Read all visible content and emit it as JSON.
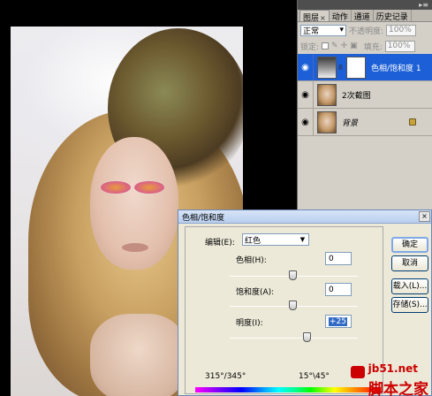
{
  "layers_panel": {
    "tabs": [
      {
        "label": "图层",
        "close": "×"
      },
      {
        "label": "动作"
      },
      {
        "label": "通道"
      },
      {
        "label": "历史记录"
      }
    ],
    "blend_mode": "正常",
    "opacity_label": "不透明度:",
    "opacity_value": "100%",
    "lock_label": "锁定:",
    "fill_label": "填充:",
    "fill_value": "100%",
    "layers": [
      {
        "name": "色相/饱和度 1",
        "selected": true
      },
      {
        "name": "2次截图"
      },
      {
        "name": "背景"
      }
    ]
  },
  "dialog": {
    "title": "色相/饱和度",
    "close": "×",
    "edit_label": "编辑(E):",
    "edit_value": "红色",
    "hue_label": "色相(H):",
    "hue_value": "0",
    "saturation_label": "饱和度(A):",
    "saturation_value": "0",
    "lightness_label": "明度(I):",
    "lightness_value": "+25",
    "range_left": "315°/345°",
    "range_right": "15°\\45°",
    "buttons": {
      "ok": "确定",
      "cancel": "取消",
      "load": "载入(L)...",
      "save": "存储(S)..."
    }
  },
  "watermark": {
    "url": "jb51.net",
    "text": "脚本之家"
  }
}
